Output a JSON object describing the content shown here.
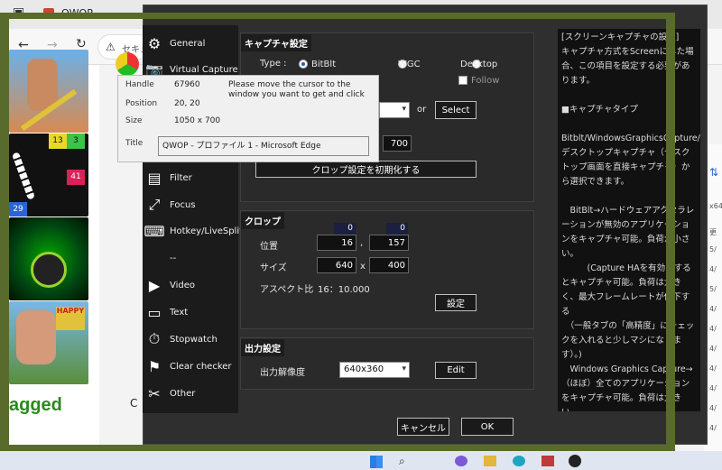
{
  "browser": {
    "tab_title": "QWOP",
    "security_label": "セキュ",
    "logo_text": "agged",
    "partial_char": "C"
  },
  "games": [
    {
      "name": "qwop"
    },
    {
      "name": "snake-numbers",
      "numbers": [
        "13",
        "3",
        "41",
        "29"
      ]
    },
    {
      "name": "ball-tunnel"
    },
    {
      "name": "happy-wheels"
    }
  ],
  "right_bg_numbers": [
    "x64",
    "更",
    "5/",
    "4/",
    "5/",
    "4/",
    "4/",
    "4/",
    "4/",
    "4/",
    "4/",
    "4/"
  ],
  "sidebar": {
    "items": [
      {
        "label": "General",
        "icon": "gear-icon"
      },
      {
        "label": "Virtual Capture",
        "icon": "camera-icon"
      },
      {
        "label": "Filter",
        "icon": "filter-icon"
      },
      {
        "label": "Focus",
        "icon": "focus-icon"
      },
      {
        "label": "Hotkey/LiveSplit",
        "icon": "keyboard-icon"
      },
      {
        "label": "--",
        "icon": ""
      },
      {
        "label": "Video",
        "icon": "video-icon"
      },
      {
        "label": "Text",
        "icon": "text-icon"
      },
      {
        "label": "Stopwatch",
        "icon": "stopwatch-icon"
      },
      {
        "label": "Clear checker",
        "icon": "flag-icon"
      },
      {
        "label": "Other",
        "icon": "tools-icon"
      }
    ]
  },
  "capture": {
    "title": "キャプチャ設定",
    "type_label": "Type :",
    "options": [
      "BitBlt",
      "WGC",
      "Desktop"
    ],
    "selected": "BitBlt",
    "follow_label": "Follow",
    "or_label": "or",
    "select_button": "Select",
    "height_value": "700",
    "reset_button": "クロップ設定を初期化する"
  },
  "crop": {
    "title": "クロップ",
    "offset_x": "0",
    "offset_y": "0",
    "position_label": "位置",
    "pos_x": "16",
    "pos_sep": ",",
    "pos_y": "157",
    "size_label": "サイズ",
    "width": "640",
    "size_sep": "x",
    "height": "400",
    "aspect_label": "アスペクト比",
    "aspect_value": "16：10.000",
    "settings_button": "設定"
  },
  "output": {
    "title": "出力設定",
    "resolution_label": "出力解像度",
    "resolution_value": "640x360",
    "edit_button": "Edit"
  },
  "footer": {
    "cancel_button": "キャンセル",
    "ok_button": "OK"
  },
  "help_text": "[スクリーンキャプチャの設定]\nキャプチャ方式をScreenにした場合、この項目を設定する必要があります。\n\n■キャプチャタイプ\n\nBitblt/WindowsGraphicsCapture/デスクトップキャプチャ（デスクトップ画面を直接キャプチャ）から選択できます。\n\n　BitBlt→ハードウェアアクセラレーションが無効のアプリケーションをキャプチャ可能。負荷が小さい。\n　　　(Capture HAを有効にするとキャプチャ可能。負荷は大きく、最大フレームレートが低下する\n　（一般タブの「高精度」にチェックを入れると少しマシになります）。)\n　Windows Graphics Capture→（ほぼ）全てのアプリケーションをキャプチャ可能。負荷は大きい。\n　Desktop→デスクトップ画面を直接キャプチャ。全てのアプリケーション",
  "tooltip": {
    "handle_label": "Handle",
    "handle_value": "67960",
    "hint": "Please move the cursor to the window you want to get and click",
    "position_label": "Position",
    "position_value": "20, 20",
    "size_label": "Size",
    "size_value": "1050 x 700",
    "title_label": "Title",
    "title_value": "QWOP - プロファイル 1 - Microsoft​ Edge"
  },
  "colors": {
    "overlay_frame": "#596b2c",
    "dialog_bg": "#2f2f2f",
    "accent": "#1a5fd0"
  }
}
